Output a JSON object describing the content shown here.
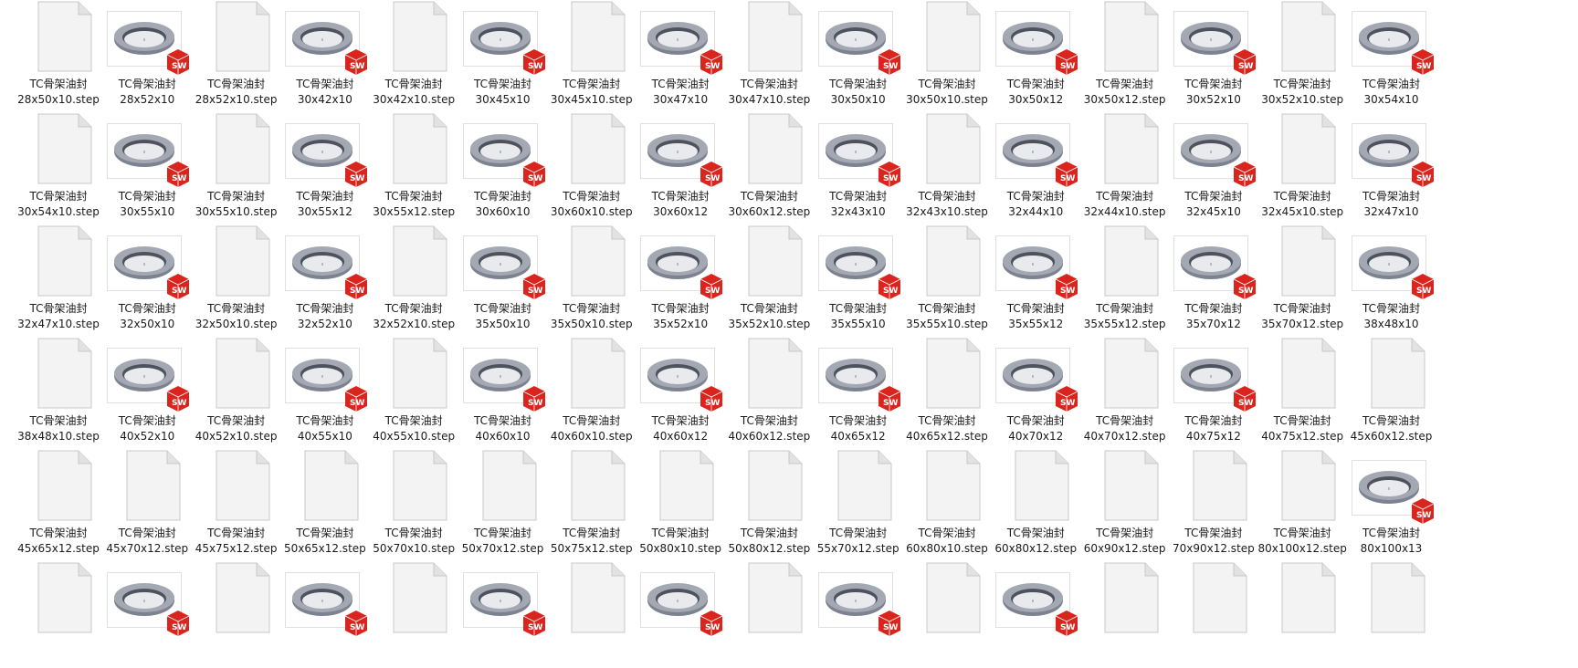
{
  "explorer": {
    "prefix": "TC骨架油封",
    "badge_text": "SW",
    "rows": [
      [
        {
          "name": "28x50x10.step",
          "type": "step"
        },
        {
          "name": "28x52x10",
          "type": "sw"
        },
        {
          "name": "28x52x10.step",
          "type": "step"
        },
        {
          "name": "30x42x10",
          "type": "sw"
        },
        {
          "name": "30x42x10.step",
          "type": "step"
        },
        {
          "name": "30x45x10",
          "type": "sw"
        },
        {
          "name": "30x45x10.step",
          "type": "step"
        },
        {
          "name": "30x47x10",
          "type": "sw"
        },
        {
          "name": "30x47x10.step",
          "type": "step"
        },
        {
          "name": "30x50x10",
          "type": "sw"
        },
        {
          "name": "30x50x10.step",
          "type": "step"
        },
        {
          "name": "30x50x12",
          "type": "sw"
        },
        {
          "name": "30x50x12.step",
          "type": "step"
        },
        {
          "name": "30x52x10",
          "type": "sw"
        },
        {
          "name": "30x52x10.step",
          "type": "step"
        },
        {
          "name": "30x54x10",
          "type": "sw"
        }
      ],
      [
        {
          "name": "30x54x10.step",
          "type": "step"
        },
        {
          "name": "30x55x10",
          "type": "sw"
        },
        {
          "name": "30x55x10.step",
          "type": "step"
        },
        {
          "name": "30x55x12",
          "type": "sw"
        },
        {
          "name": "30x55x12.step",
          "type": "step"
        },
        {
          "name": "30x60x10",
          "type": "sw"
        },
        {
          "name": "30x60x10.step",
          "type": "step"
        },
        {
          "name": "30x60x12",
          "type": "sw"
        },
        {
          "name": "30x60x12.step",
          "type": "step"
        },
        {
          "name": "32x43x10",
          "type": "sw"
        },
        {
          "name": "32x43x10.step",
          "type": "step"
        },
        {
          "name": "32x44x10",
          "type": "sw"
        },
        {
          "name": "32x44x10.step",
          "type": "step"
        },
        {
          "name": "32x45x10",
          "type": "sw"
        },
        {
          "name": "32x45x10.step",
          "type": "step"
        },
        {
          "name": "32x47x10",
          "type": "sw"
        }
      ],
      [
        {
          "name": "32x47x10.step",
          "type": "step"
        },
        {
          "name": "32x50x10",
          "type": "sw"
        },
        {
          "name": "32x50x10.step",
          "type": "step"
        },
        {
          "name": "32x52x10",
          "type": "sw"
        },
        {
          "name": "32x52x10.step",
          "type": "step"
        },
        {
          "name": "35x50x10",
          "type": "sw"
        },
        {
          "name": "35x50x10.step",
          "type": "step"
        },
        {
          "name": "35x52x10",
          "type": "sw"
        },
        {
          "name": "35x52x10.step",
          "type": "step"
        },
        {
          "name": "35x55x10",
          "type": "sw"
        },
        {
          "name": "35x55x10.step",
          "type": "step"
        },
        {
          "name": "35x55x12",
          "type": "sw"
        },
        {
          "name": "35x55x12.step",
          "type": "step"
        },
        {
          "name": "35x70x12",
          "type": "sw"
        },
        {
          "name": "35x70x12.step",
          "type": "step"
        },
        {
          "name": "38x48x10",
          "type": "sw"
        }
      ],
      [
        {
          "name": "38x48x10.step",
          "type": "step"
        },
        {
          "name": "40x52x10",
          "type": "sw"
        },
        {
          "name": "40x52x10.step",
          "type": "step"
        },
        {
          "name": "40x55x10",
          "type": "sw"
        },
        {
          "name": "40x55x10.step",
          "type": "step"
        },
        {
          "name": "40x60x10",
          "type": "sw"
        },
        {
          "name": "40x60x10.step",
          "type": "step"
        },
        {
          "name": "40x60x12",
          "type": "sw"
        },
        {
          "name": "40x60x12.step",
          "type": "step"
        },
        {
          "name": "40x65x12",
          "type": "sw"
        },
        {
          "name": "40x65x12.step",
          "type": "step"
        },
        {
          "name": "40x70x12",
          "type": "sw"
        },
        {
          "name": "40x70x12.step",
          "type": "step"
        },
        {
          "name": "40x75x12",
          "type": "sw"
        },
        {
          "name": "40x75x12.step",
          "type": "step"
        },
        {
          "name": "45x60x12.step",
          "type": "step"
        }
      ],
      [
        {
          "name": "45x65x12.step",
          "type": "step"
        },
        {
          "name": "45x70x12.step",
          "type": "step"
        },
        {
          "name": "45x75x12.step",
          "type": "step"
        },
        {
          "name": "50x65x12.step",
          "type": "step"
        },
        {
          "name": "50x70x10.step",
          "type": "step"
        },
        {
          "name": "50x70x12.step",
          "type": "step"
        },
        {
          "name": "50x75x12.step",
          "type": "step"
        },
        {
          "name": "50x80x10.step",
          "type": "step"
        },
        {
          "name": "50x80x12.step",
          "type": "step"
        },
        {
          "name": "55x70x12.step",
          "type": "step"
        },
        {
          "name": "60x80x10.step",
          "type": "step"
        },
        {
          "name": "60x80x12.step",
          "type": "step"
        },
        {
          "name": "60x90x12.step",
          "type": "step"
        },
        {
          "name": "70x90x12.step",
          "type": "step"
        },
        {
          "name": "80x100x12.step",
          "type": "step"
        },
        {
          "name": "80x100x13",
          "type": "sw"
        }
      ],
      [
        {
          "type": "step"
        },
        {
          "type": "sw"
        },
        {
          "type": "step"
        },
        {
          "type": "sw"
        },
        {
          "type": "step"
        },
        {
          "type": "sw"
        },
        {
          "type": "step"
        },
        {
          "type": "sw"
        },
        {
          "type": "step"
        },
        {
          "type": "sw"
        },
        {
          "type": "step"
        },
        {
          "type": "sw"
        },
        {
          "type": "step"
        },
        {
          "type": "step"
        },
        {
          "type": "step"
        },
        {
          "type": "step"
        }
      ]
    ]
  },
  "colors": {
    "badge_red": "#d9251d",
    "ring_gray": "#7c8290",
    "ring_dark": "#4d525d",
    "doc_fill": "#f3f3f3",
    "doc_border": "#c8c8c8"
  }
}
